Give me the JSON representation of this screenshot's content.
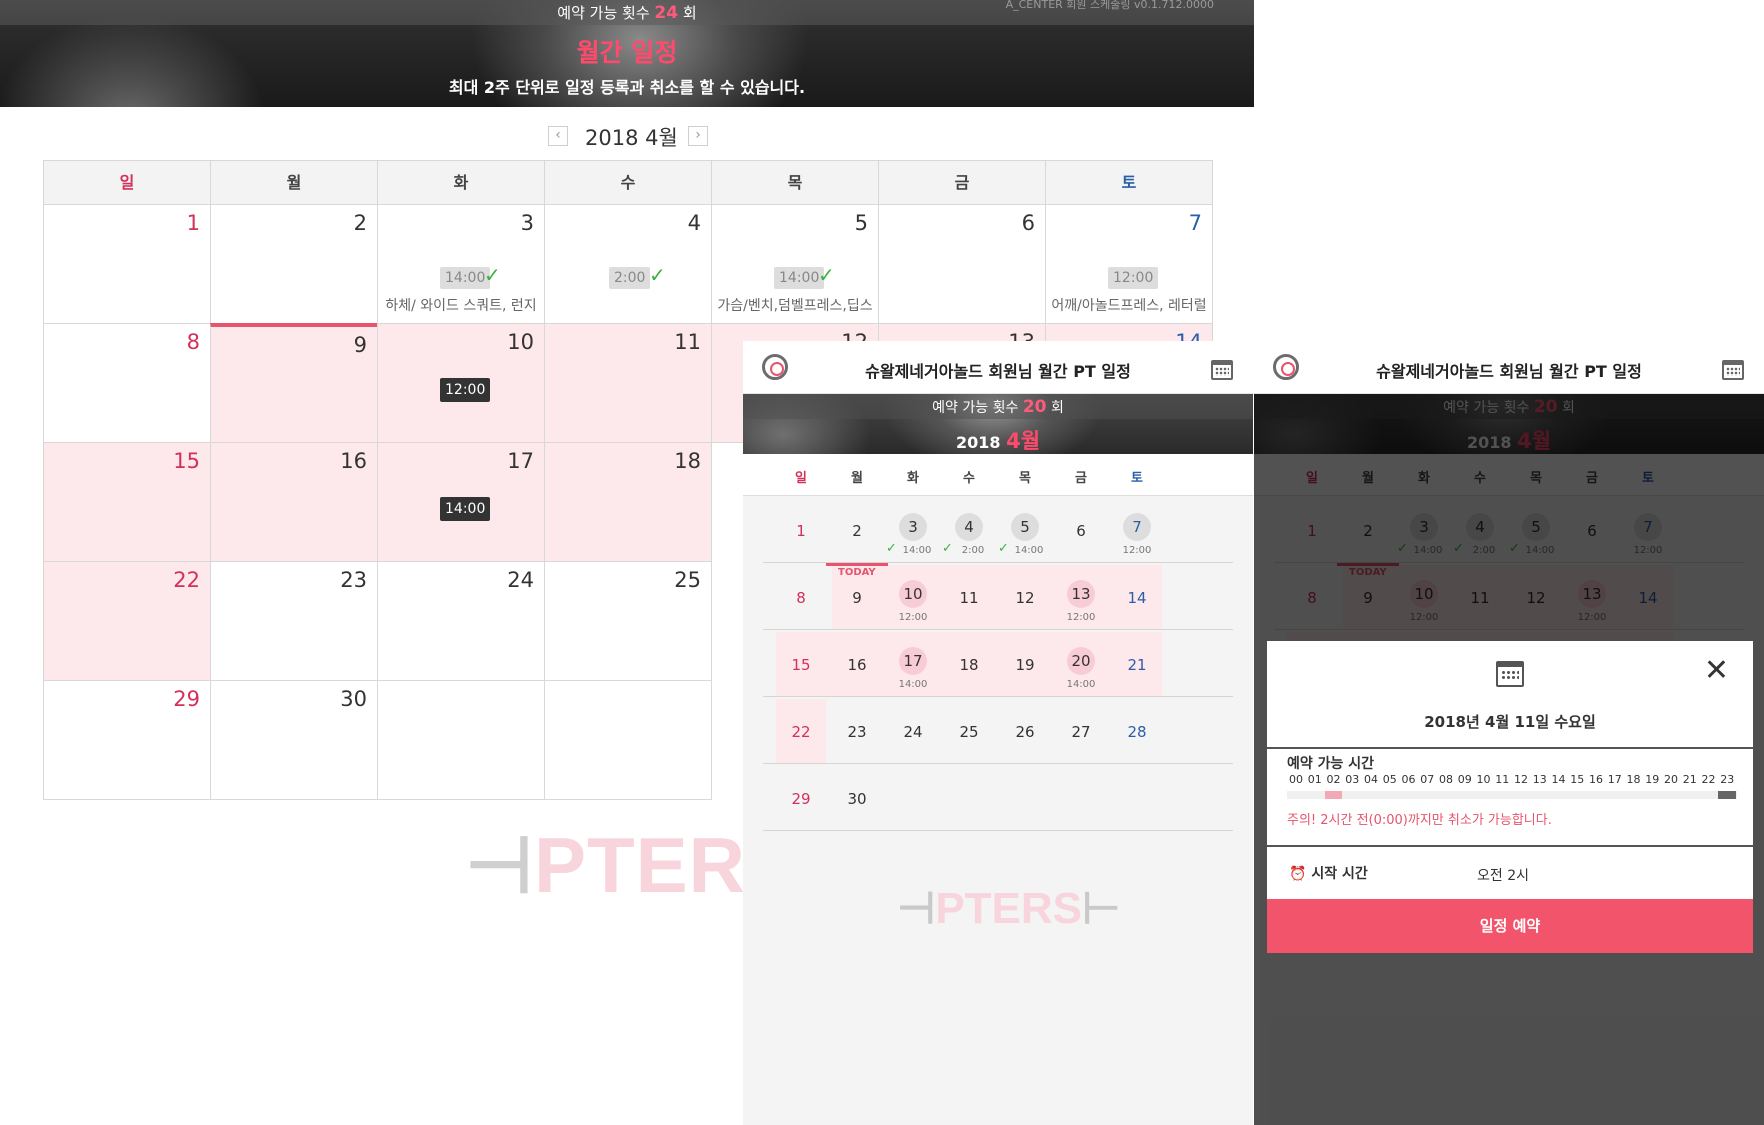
{
  "desktop": {
    "count_label": "예약 가능 횟수",
    "count_value": "24",
    "count_unit": "회",
    "version": "A_CENTER 회원 스케줄링 v0.1.712.0000",
    "title": "월간 일정",
    "subtitle": "최대 2주 단위로 일정 등록과 취소를 할 수 있습니다.",
    "month_label": "2018 4월",
    "prev": "‹",
    "next": "›",
    "weekdays": [
      "일",
      "월",
      "화",
      "수",
      "목",
      "금",
      "토"
    ],
    "days": {
      "d1": "1",
      "d2": "2",
      "d3": "3",
      "d4": "4",
      "d5": "5",
      "d6": "6",
      "d7": "7",
      "d8": "8",
      "d9": "9",
      "d10": "10",
      "d11": "11",
      "d12": "12",
      "d13": "13",
      "d14": "14",
      "d15": "15",
      "d16": "16",
      "d17": "17",
      "d18": "18",
      "d22": "22",
      "d23": "23",
      "d24": "24",
      "d25": "25",
      "d29": "29",
      "d30": "30"
    },
    "events": {
      "e3_time": "14:00",
      "e3_note": "하체/ 와이드 스쿼트, 런지",
      "e4_time": "2:00",
      "e5_time": "14:00",
      "e5_note": "가슴/벤치,덤벨프레스,딥스",
      "e7_time": "12:00",
      "e7_note": "어깨/아놀드프레스, 레터럴",
      "e10_time": "12:00",
      "e17_time": "14:00"
    },
    "check": "✓",
    "logo": "PTERS"
  },
  "mobile": {
    "header_title": "슈왈제네거아놀드 회원님 월간 PT 일정",
    "count_label": "예약 가능 횟수",
    "count_value": "20",
    "count_unit": "회",
    "year": "2018",
    "month": "4월",
    "weekdays": [
      "일",
      "월",
      "화",
      "수",
      "목",
      "금",
      "토"
    ],
    "today_label": "TODAY",
    "days": [
      "1",
      "2",
      "3",
      "4",
      "5",
      "6",
      "7",
      "8",
      "9",
      "10",
      "11",
      "12",
      "13",
      "14",
      "15",
      "16",
      "17",
      "18",
      "19",
      "20",
      "21",
      "22",
      "23",
      "24",
      "25",
      "26",
      "27",
      "28",
      "29",
      "30"
    ],
    "times": {
      "t3": "14:00",
      "t4": "2:00",
      "t5": "14:00",
      "t7": "12:00",
      "t10": "12:00",
      "t13": "12:00",
      "t17": "14:00",
      "t20": "14:00"
    },
    "check": "✓",
    "logo": "PTERS"
  },
  "popup": {
    "date": "2018년 4월 11일 수요일",
    "close": "✕",
    "available_label": "예약 가능 시간",
    "hours": [
      "00",
      "01",
      "02",
      "03",
      "04",
      "05",
      "06",
      "07",
      "08",
      "09",
      "10",
      "11",
      "12",
      "13",
      "14",
      "15",
      "16",
      "17",
      "18",
      "19",
      "20",
      "21",
      "22",
      "23"
    ],
    "selected_hour": "02",
    "warning": "주의! 2시간 전(0:00)까지만 취소가 가능합니다.",
    "start_label": "시작 시간",
    "start_value": "오전 2시",
    "submit": "일정 예약",
    "colors": {
      "accent": "#f2546c",
      "selected": "#f4a7b6",
      "unavailable": "#666666"
    }
  }
}
